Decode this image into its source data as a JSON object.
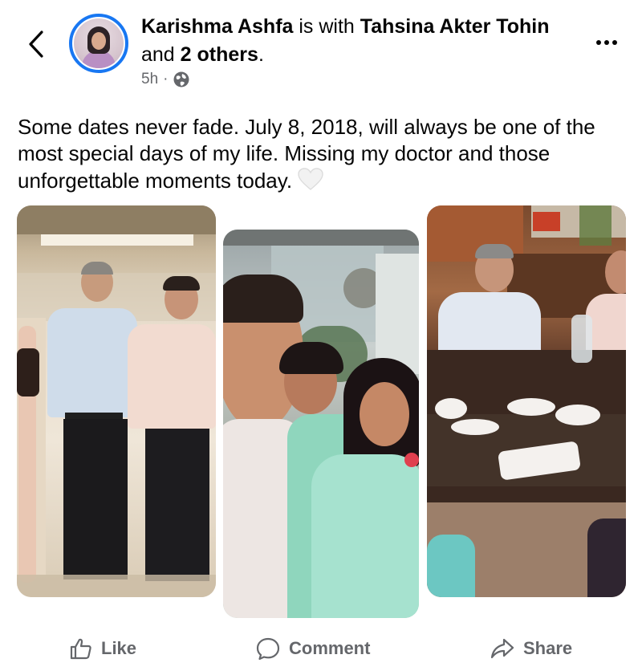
{
  "post": {
    "author": "Karishma Ashfa",
    "with_text": "is with",
    "tagged": "Tahsina Akter Tohin",
    "and_text": "and",
    "others": "2 others",
    "period": ".",
    "time": "5h",
    "separator": "·",
    "audience_icon": "globe-icon",
    "text": "Some dates never fade. July 8, 2018, will always be one of the most special days of my life. Missing my doctor and those unforgettable moments today."
  },
  "actions": {
    "like": "Like",
    "comment": "Comment",
    "share": "Share"
  },
  "colors": {
    "accent": "#1877f2",
    "secondary_text": "#65676b",
    "primary_text": "#050505"
  }
}
